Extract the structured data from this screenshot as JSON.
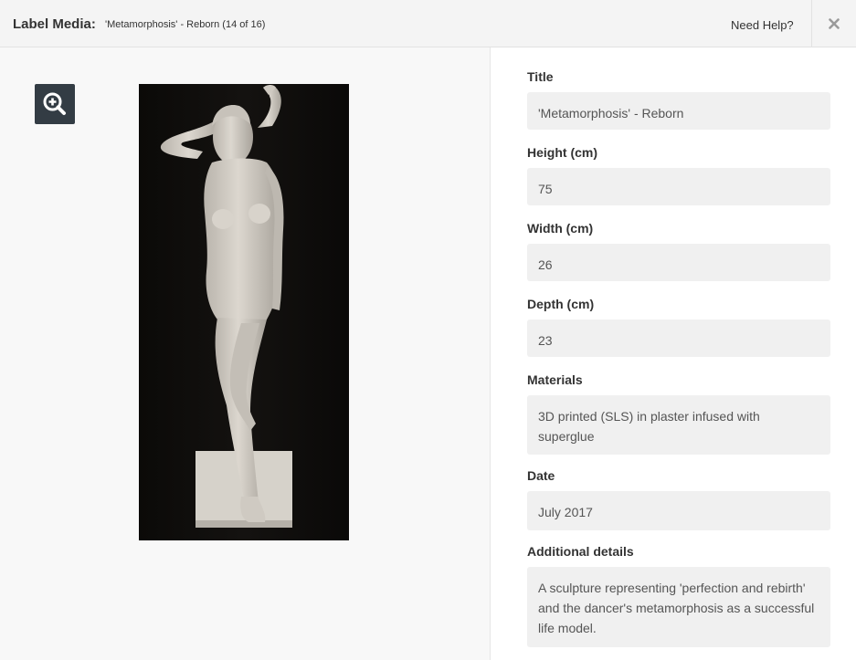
{
  "header": {
    "title": "Label Media:",
    "subtitle": "'Metamorphosis' - Reborn (14 of 16)",
    "help": "Need Help?"
  },
  "fields": {
    "title_label": "Title",
    "title_value": "'Metamorphosis' - Reborn",
    "height_label": "Height (cm)",
    "height_value": "75",
    "width_label": "Width (cm)",
    "width_value": "26",
    "depth_label": "Depth (cm)",
    "depth_value": "23",
    "materials_label": "Materials",
    "materials_value": "3D printed (SLS) in plaster infused with superglue",
    "date_label": "Date",
    "date_value": "July 2017",
    "details_label": "Additional details",
    "details_value": "A sculpture representing 'perfection and rebirth' and the dancer's metamorphosis as a successful life model."
  },
  "icons": {
    "zoom": "zoom-in-icon",
    "close": "close-icon"
  }
}
